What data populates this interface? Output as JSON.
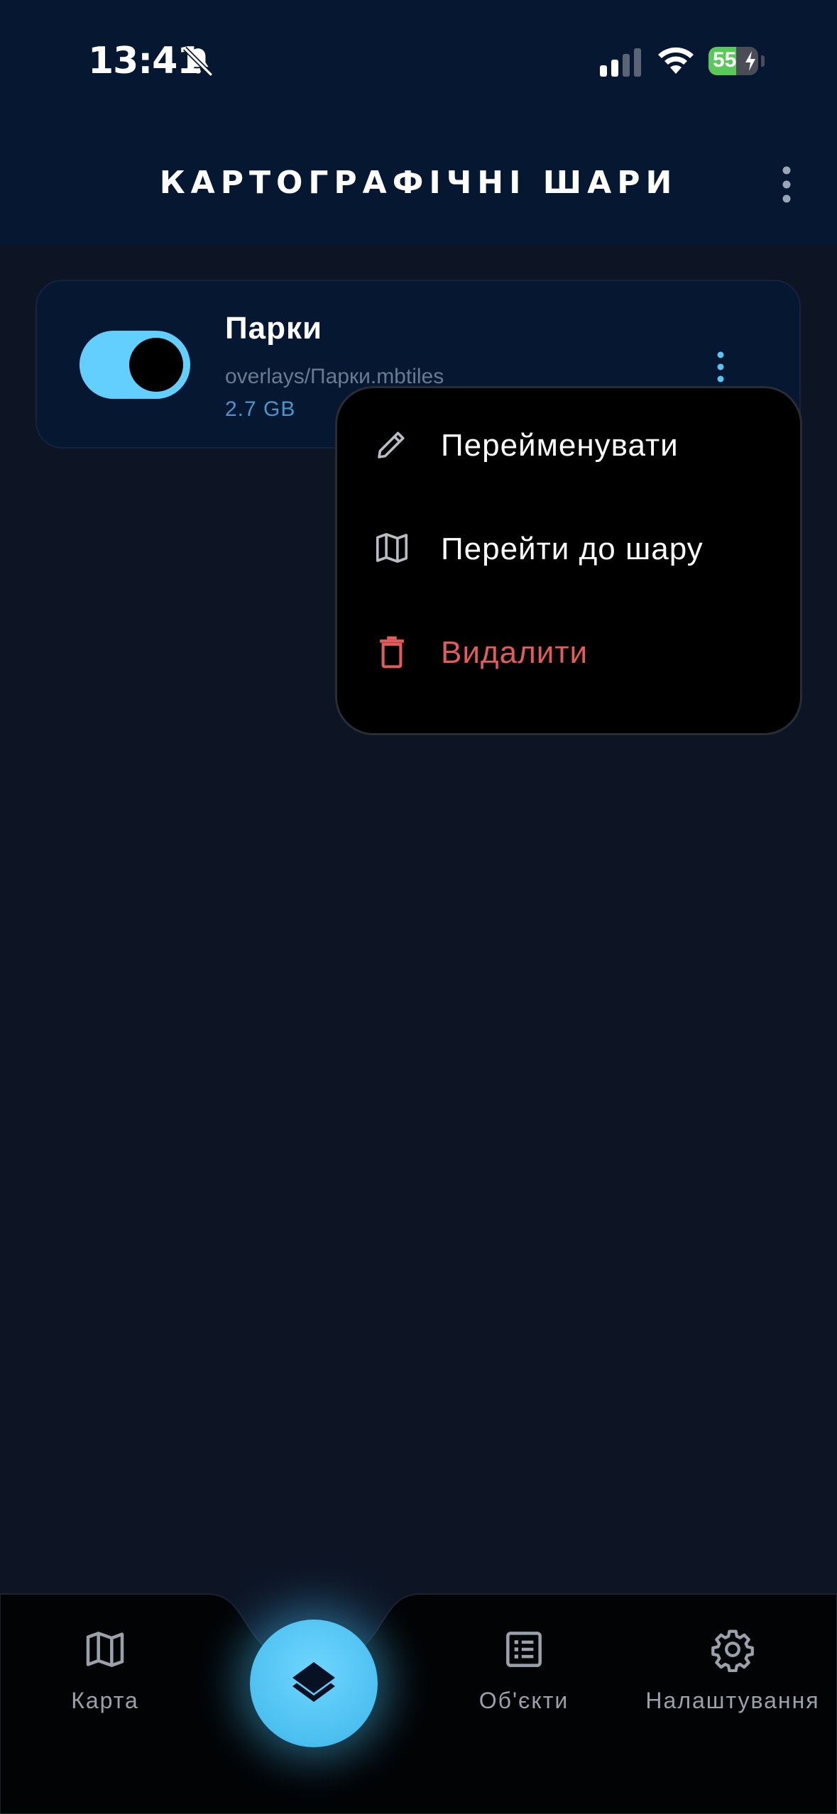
{
  "status_bar": {
    "time": "13:41",
    "battery_level": "55",
    "battery_fraction": 0.55,
    "icons": [
      "bell-slash-icon",
      "cellular-signal-icon",
      "wifi-icon",
      "battery-charging-icon"
    ]
  },
  "header": {
    "title": "КАРТОГРАФІЧНІ ШАРИ",
    "menu_icon": "more-vertical-icon"
  },
  "layers": [
    {
      "name": "Парки",
      "path": "overlays/Парки.mbtiles",
      "size": "2.7 GB",
      "enabled": true
    }
  ],
  "context_menu": {
    "items": [
      {
        "label": "Перейменувати",
        "icon": "pencil-icon"
      },
      {
        "label": "Перейти до шару",
        "icon": "map-icon"
      },
      {
        "label": "Видалити",
        "icon": "trash-icon",
        "danger": true
      }
    ]
  },
  "bottom_nav": {
    "items": [
      {
        "label": "Карта",
        "icon": "map-icon"
      },
      {
        "label": "Об'єкти",
        "icon": "list-icon"
      },
      {
        "label": "Налаштування",
        "icon": "gear-icon"
      }
    ],
    "active_icon": "layers-icon"
  },
  "colors": {
    "header_bg": "#061731",
    "body_bg": "#0d1525",
    "accent": "#62cfff",
    "danger": "#e25c5c",
    "nav_bg": "#020305"
  }
}
